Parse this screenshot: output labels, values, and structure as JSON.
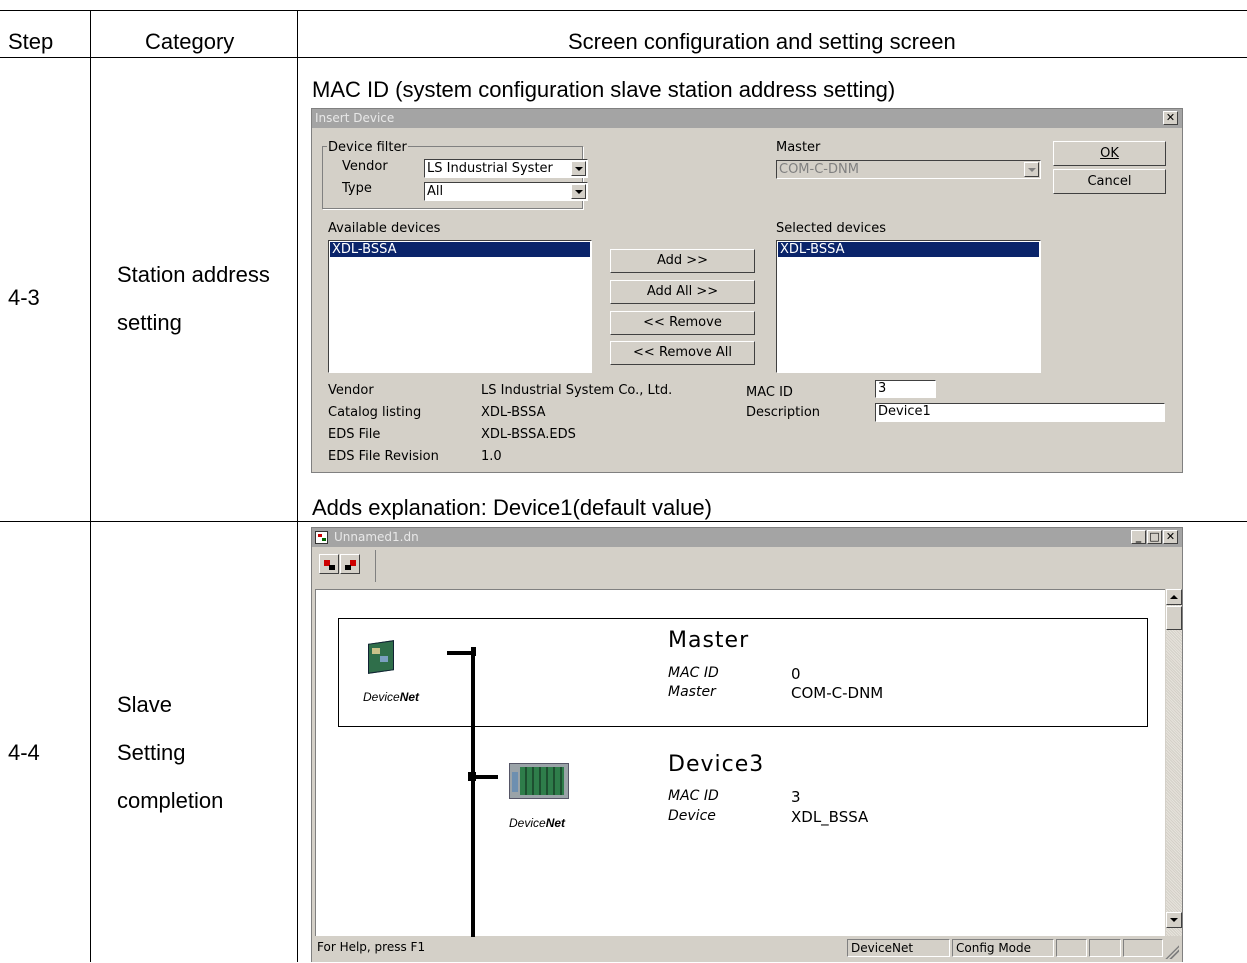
{
  "table": {
    "headers": [
      "Step",
      "Category",
      "Screen configuration and setting screen"
    ],
    "rows": [
      {
        "step": "4-3",
        "category_lines": [
          "Station address",
          "setting"
        ],
        "caption_top": "MAC ID (system configuration slave station address setting)",
        "caption_bottom": "Adds explanation: Device1(default value)"
      },
      {
        "step": "4-4",
        "category_lines": [
          "Slave",
          "Setting",
          "completion"
        ]
      }
    ]
  },
  "insert_dialog": {
    "title": "Insert Device",
    "close_glyph": "✕",
    "device_filter": {
      "label": "Device filter",
      "vendor_label": "Vendor",
      "vendor_value": "LS Industrial Syster",
      "type_label": "Type",
      "type_value": "All"
    },
    "master_label": "Master",
    "master_value": "COM-C-DNM",
    "ok_label": "OK",
    "cancel_label": "Cancel",
    "available_label": "Available devices",
    "available_items": [
      "XDL-BSSA"
    ],
    "selected_label": "Selected devices",
    "selected_items": [
      "XDL-BSSA"
    ],
    "add_label": "Add >>",
    "add_all_label": "Add All >>",
    "remove_label": "<< Remove",
    "remove_all_label": "<< Remove All",
    "info": {
      "vendor_label": "Vendor",
      "vendor_value": "LS Industrial System Co., Ltd.",
      "catalog_label": "Catalog listing",
      "catalog_value": "XDL-BSSA",
      "eds_label": "EDS File",
      "eds_value": "XDL-BSSA.EDS",
      "eds_rev_label": "EDS File Revision",
      "eds_rev_value": "1.0",
      "mac_label": "MAC ID",
      "mac_value": "3",
      "desc_label": "Description",
      "desc_value": "Device1"
    }
  },
  "net_window": {
    "title": "Unnamed1.dn",
    "min_glyph": "_",
    "max_glyph": "□",
    "close_glyph": "✕",
    "master": {
      "name": "Master",
      "mac_key": "MAC ID",
      "mac_value": "0",
      "type_key": "Master",
      "type_value": "COM-C-DNM",
      "logo_a": "Device",
      "logo_b": "Net"
    },
    "device": {
      "name": "Device3",
      "mac_key": "MAC ID",
      "mac_value": "3",
      "type_key": "Device",
      "type_value": "XDL_BSSA",
      "logo_a": "Device",
      "logo_b": "Net"
    },
    "status": {
      "help": "For Help, press F1",
      "pane1": "DeviceNet",
      "pane2": "Config Mode"
    }
  }
}
